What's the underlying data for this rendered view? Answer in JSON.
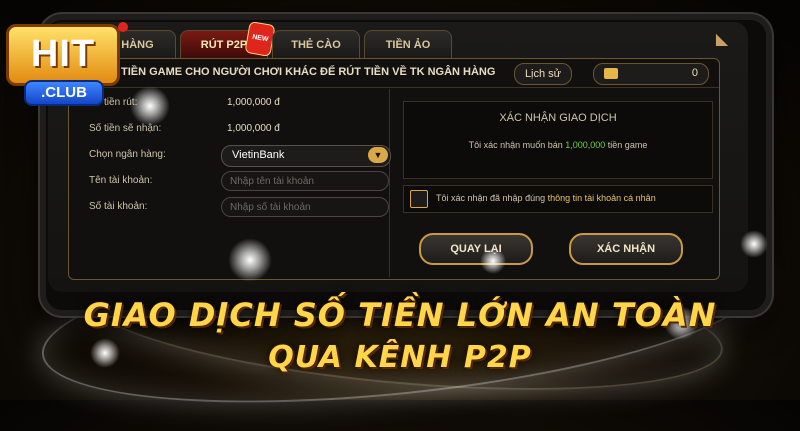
{
  "brand": {
    "logo_text": "HIT",
    "logo_sub": ".CLUB"
  },
  "tabs": [
    {
      "label": "NẠP TIỀN HÀNG",
      "visible": "N HÀNG"
    },
    {
      "label": "RÚT P2P",
      "badge": "NEW"
    },
    {
      "label": "THẺ CÀO"
    },
    {
      "label": "TIỀN ẢO"
    }
  ],
  "header": {
    "title": "TIỀN GAME CHO NGƯỜI CHƠI KHÁC ĐỂ RÚT TIỀN VỀ TK NGÂN HÀNG",
    "history_label": "Lịch sử",
    "balance": "0"
  },
  "form": {
    "amount_label": "Số tiền rút:",
    "amount_value": "1,000,000 đ",
    "receive_label": "Số tiền sẽ nhận:",
    "receive_value": "1,000,000 đ",
    "bank_label": "Chọn ngân hàng:",
    "bank_value": "VietinBank",
    "account_name_label": "Tên tài khoản:",
    "account_name_placeholder": "Nhập tên tài khoản",
    "account_number_label": "Số tài khoản:",
    "account_number_placeholder": "Nhập số tài khoản"
  },
  "confirm": {
    "title": "XÁC NHẬN GIAO DỊCH",
    "msg_prefix": "Tôi xác nhận muốn bán",
    "msg_amount": "1,000,000",
    "msg_suffix": "tiền game",
    "check_prefix": "Tôi xác nhận đã nhập đúng",
    "check_highlight": "thông tin tài khoản cá nhân",
    "back_label": "QUAY LẠI",
    "confirm_label": "XÁC NHẬN"
  },
  "headline": {
    "line1": "GIAO DỊCH SỐ TIỀN LỚN AN TOÀN",
    "line2": "QUA KÊNH P2P"
  },
  "colors": {
    "accent_gold": "#d9a847",
    "headline": "#ffd54a",
    "highlight_green": "#6bd04a",
    "tab_active": "#7a1a14"
  }
}
